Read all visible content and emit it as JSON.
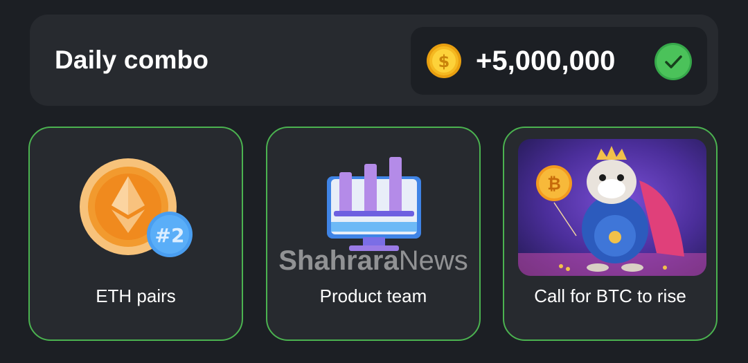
{
  "header": {
    "title": "Daily combo",
    "reward_amount": "+5,000,000",
    "coin_icon": "dollar-coin-icon",
    "status_icon": "checkmark-icon"
  },
  "cards": [
    {
      "label": "ETH pairs",
      "icon": "ethereum-coin-icon",
      "badge": "#2"
    },
    {
      "label": "Product team",
      "icon": "monitor-chart-icon"
    },
    {
      "label": "Call for BTC to rise",
      "icon": "hamster-king-btc-balloon-image"
    }
  ],
  "watermark": {
    "text_bold": "Shahrara",
    "text_light": "News"
  },
  "colors": {
    "background": "#1c1f24",
    "panel": "#272a2f",
    "card_border": "#4bb350",
    "gold": "#f5b921",
    "success": "#36a84a"
  }
}
